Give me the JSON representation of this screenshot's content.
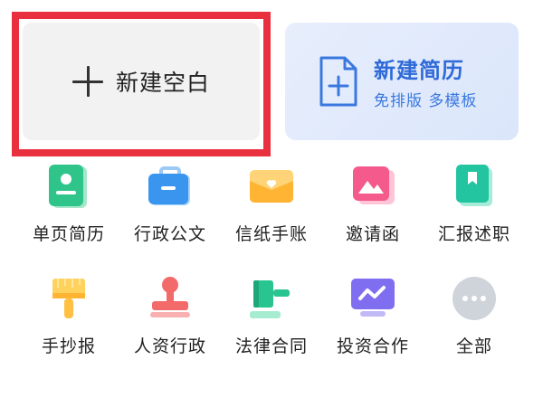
{
  "top_cards": {
    "blank": {
      "label": "新建空白"
    },
    "resume": {
      "title": "新建简历",
      "subtitle": "免排版 多模板"
    }
  },
  "grid_items": [
    {
      "label": "单页简历",
      "icon": "id-card-icon"
    },
    {
      "label": "行政公文",
      "icon": "briefcase-icon"
    },
    {
      "label": "信纸手账",
      "icon": "envelope-heart-icon"
    },
    {
      "label": "邀请函",
      "icon": "picture-card-icon"
    },
    {
      "label": "汇报述职",
      "icon": "bookmark-book-icon"
    },
    {
      "label": "手抄报",
      "icon": "paint-brush-icon"
    },
    {
      "label": "人资行政",
      "icon": "stamp-icon"
    },
    {
      "label": "法律合同",
      "icon": "gavel-icon"
    },
    {
      "label": "投资合作",
      "icon": "monitor-chart-icon"
    },
    {
      "label": "全部",
      "icon": "more-dots-icon"
    }
  ],
  "colors": {
    "highlight_border": "#e8303f",
    "resume_accent": "#2f6ad8"
  }
}
